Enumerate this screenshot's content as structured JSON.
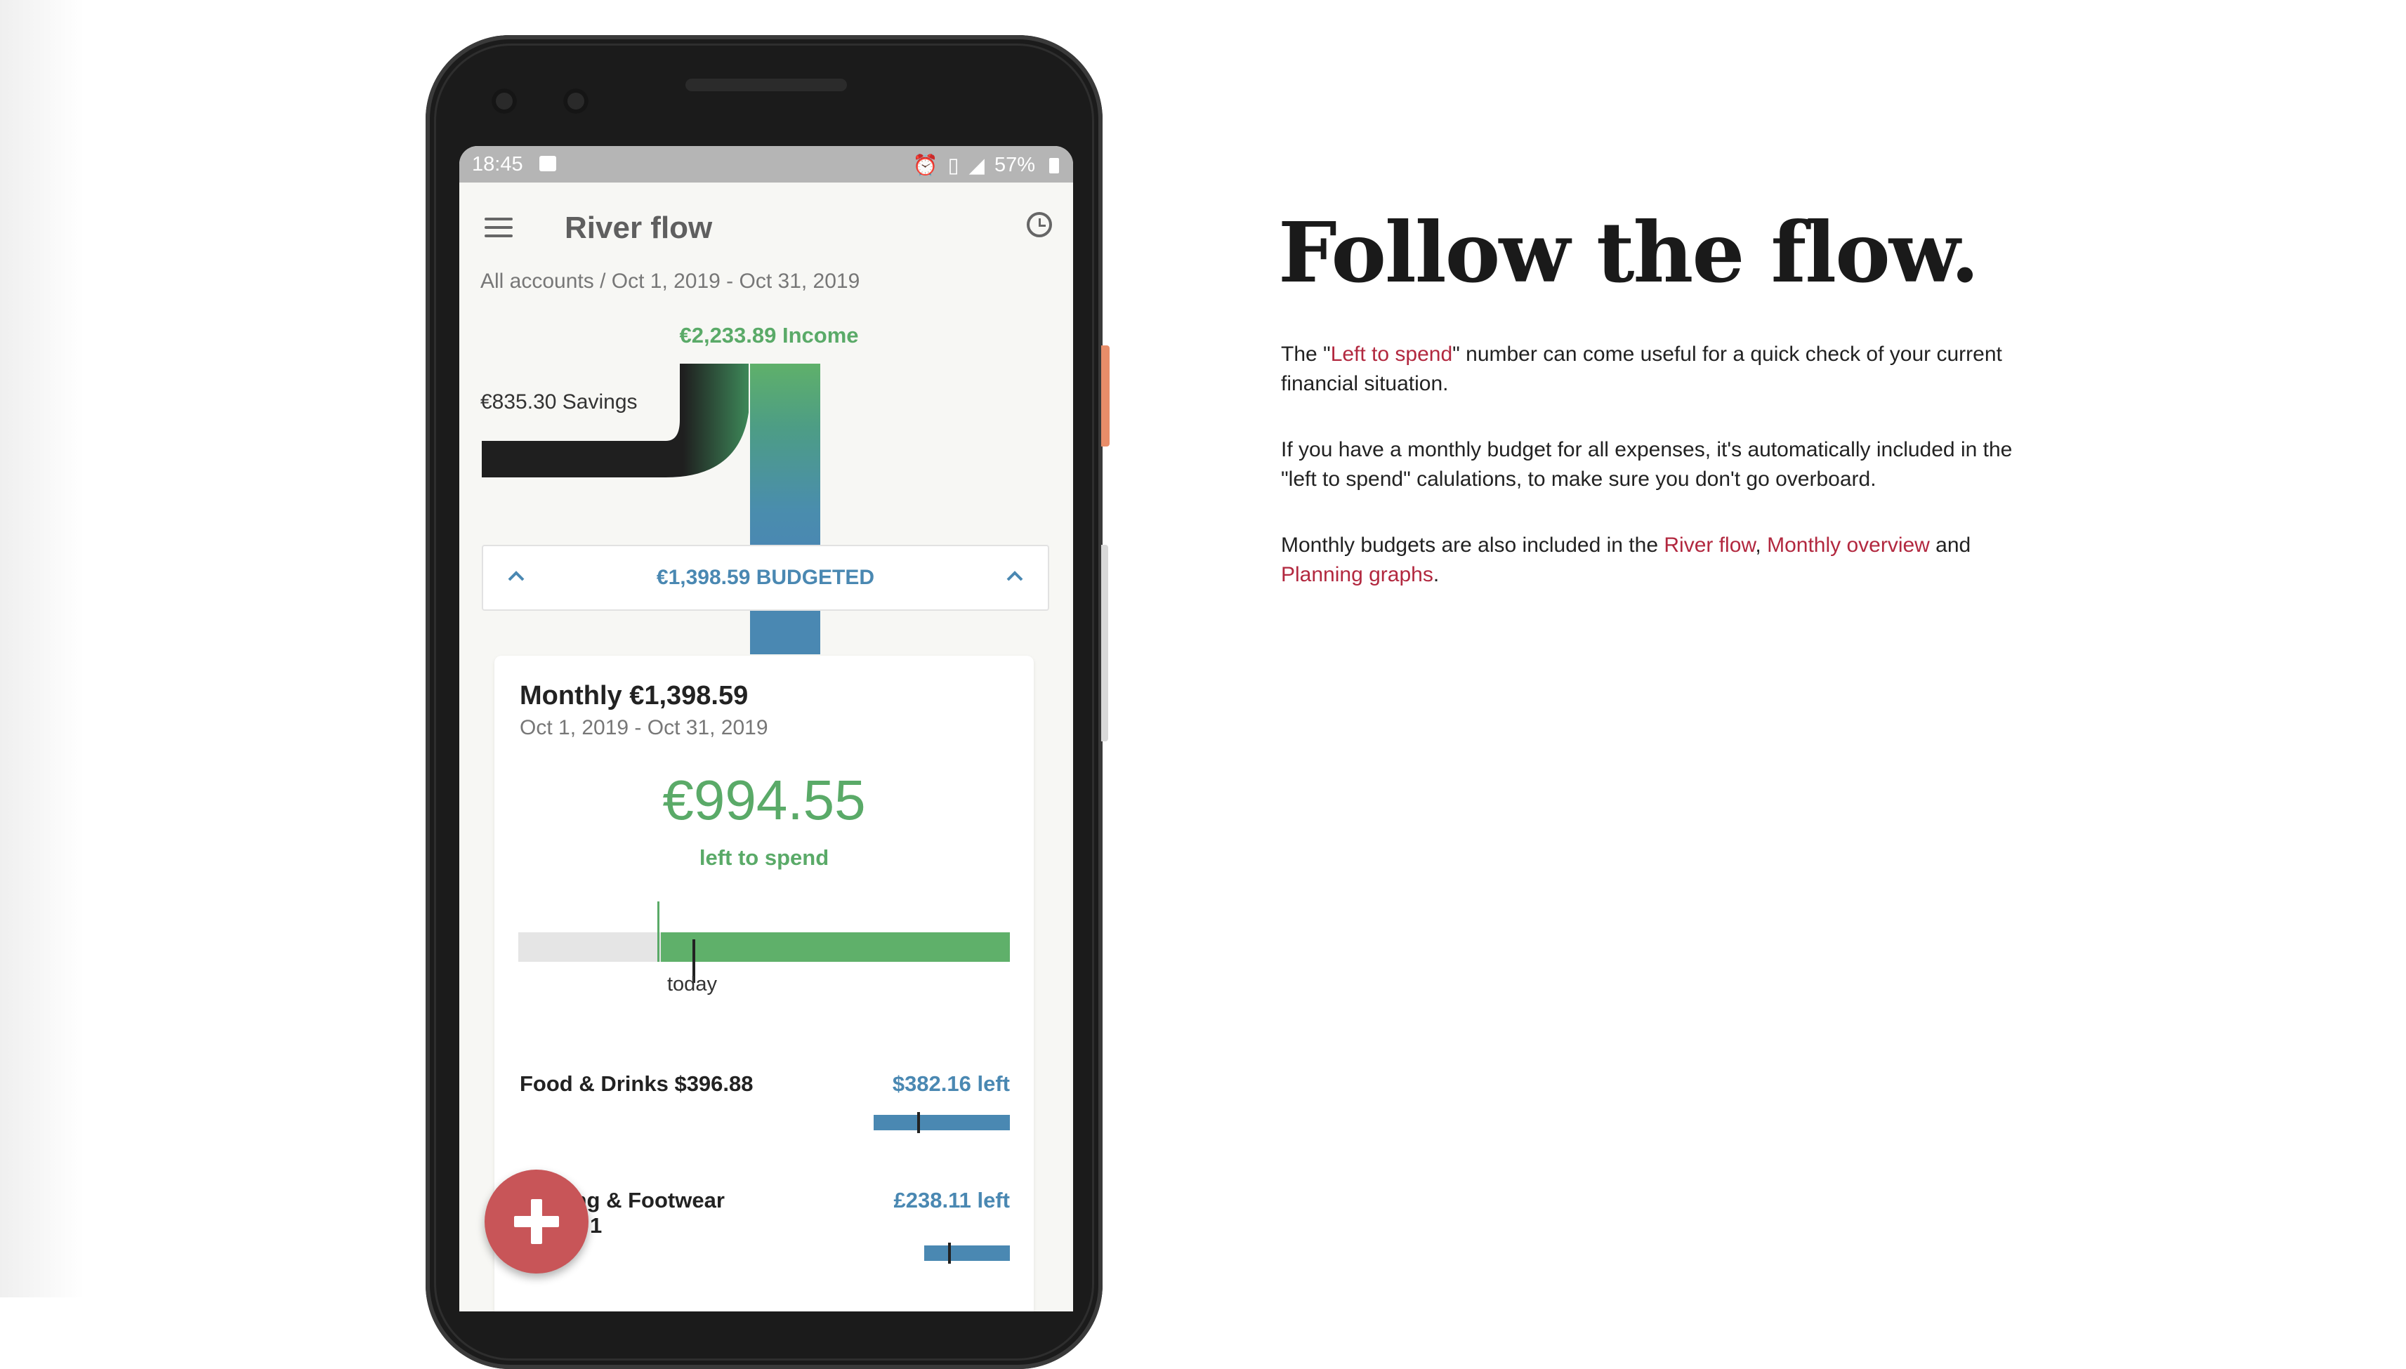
{
  "phone": {
    "statusbar": {
      "time": "18:45",
      "battery": "57%"
    },
    "appbar": {
      "title": "River flow",
      "menu_icon": "menu-icon",
      "history_icon": "clock-icon"
    },
    "breadcrumb": "All accounts / Oct 1, 2019 - Oct 31, 2019",
    "flow": {
      "income_label": "€2,233.89 Income",
      "savings_label": "€835.30 Savings",
      "budgeted_label": "€1,398.59 BUDGETED"
    },
    "card": {
      "title": "Monthly €1,398.59",
      "subtitle": "Oct 1, 2019 - Oct 31, 2019",
      "left_amount": "€994.55",
      "left_label": "left to spend",
      "today_label": "today",
      "progress_spent_fraction": 0.29,
      "rows": [
        {
          "name": "Food & Drinks $396.88",
          "left": "$382.16 left"
        },
        {
          "name_line1": "ing & Footwear",
          "name_line2": "1",
          "left": "£238.11 left"
        }
      ]
    },
    "fab_icon": "plus-icon"
  },
  "marketing": {
    "headline": "Follow the flow.",
    "p1": {
      "before": "The \"",
      "link": "Left to spend",
      "after": "\" number can come useful for a quick check of your current financial situation."
    },
    "p2": "If you have a monthly budget for all expenses, it's automatically included in the \"left to spend\" calulations, to make sure you don't go overboard.",
    "p3": {
      "before": "Monthly budgets are also included in the ",
      "link1": "River flow",
      "sep": ", ",
      "link2": "Monthly overview",
      "mid": " and ",
      "link3": "Planning graphs",
      "end": "."
    }
  },
  "colors": {
    "green": "#5aaa68",
    "blue": "#4a88b2",
    "link": "#b2283f",
    "fab": "#c85558"
  }
}
